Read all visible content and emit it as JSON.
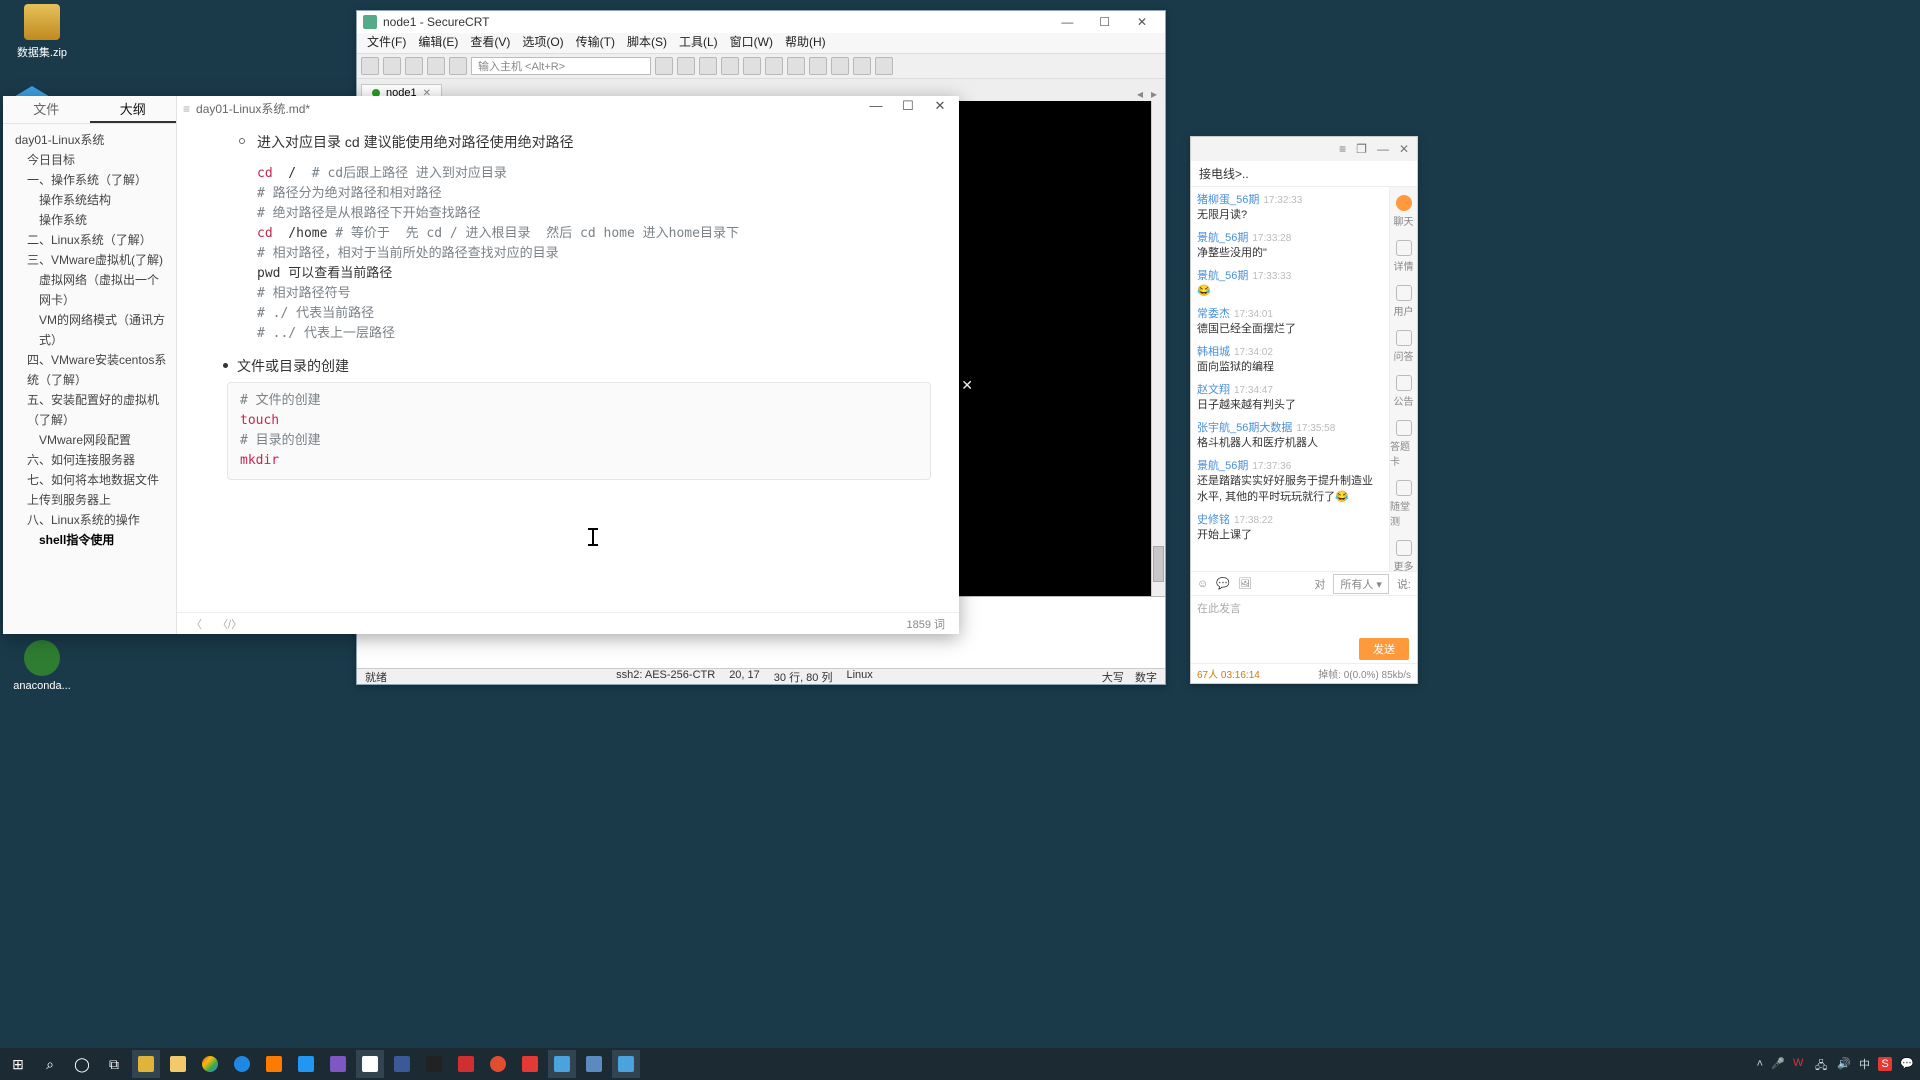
{
  "desktop": {
    "icon1": {
      "label": "数据集.zip"
    },
    "icon2": {
      "label": "anaconda..."
    }
  },
  "crt": {
    "title": "node1 - SecureCRT",
    "menu": [
      "文件(F)",
      "编辑(E)",
      "查看(V)",
      "选项(O)",
      "传输(T)",
      "脚本(S)",
      "工具(L)",
      "窗口(W)",
      "帮助(H)"
    ],
    "host_ph": "输入主机 <Alt+R>",
    "tab": "node1",
    "status": {
      "left": "就绪",
      "ssh": "ssh2: AES-256-CTR",
      "pos": "20, 17",
      "size": "30 行, 80 列",
      "os": "Linux",
      "caps": "大写",
      "num": "数字"
    }
  },
  "typ": {
    "file": "day01-Linux系统.md*",
    "tabs": {
      "file": "文件",
      "outline": "大纲"
    },
    "outline": [
      {
        "t": "day01-Linux系统",
        "lv": 0
      },
      {
        "t": "今日目标",
        "lv": 1
      },
      {
        "t": "一、操作系统（了解）",
        "lv": 1
      },
      {
        "t": "操作系统结构",
        "lv": 2
      },
      {
        "t": "操作系统",
        "lv": 2
      },
      {
        "t": "二、Linux系统（了解）",
        "lv": 1
      },
      {
        "t": "三、VMware虚拟机(了解)",
        "lv": 1
      },
      {
        "t": "虚拟网络（虚拟出一个网卡）",
        "lv": 2
      },
      {
        "t": "VM的网络模式（通讯方式）",
        "lv": 2
      },
      {
        "t": "四、VMware安装centos系统（了解）",
        "lv": 1
      },
      {
        "t": "五、安装配置好的虚拟机（了解）",
        "lv": 1
      },
      {
        "t": "VMware网段配置",
        "lv": 2
      },
      {
        "t": "六、如何连接服务器",
        "lv": 1
      },
      {
        "t": "七、如何将本地数据文件上传到服务器上",
        "lv": 1
      },
      {
        "t": "八、Linux系统的操作",
        "lv": 1
      },
      {
        "t": "shell指令使用",
        "lv": 2,
        "bold": true
      }
    ],
    "doc": {
      "bullet1": "进入对应目录 cd 建议能使用绝对路径使用绝对路径",
      "code1": [
        {
          "kw": "cd",
          "tx": "  /  ",
          "cm": "# cd后跟上路径 进入到对应目录"
        },
        {
          "tx": ""
        },
        {
          "cm": "# 路径分为绝对路径和相对路径"
        },
        {
          "cm": "# 绝对路径是从根路径下开始查找路径"
        },
        {
          "kw": "cd",
          "tx": "  /home ",
          "cm": "# 等价于  先 cd / 进入根目录  然后 cd home 进入home目录下"
        },
        {
          "cm": "# 相对路径，相对于当前所处的路径查找对应的目录"
        },
        {
          "tx": "pwd 可以查看当前路径"
        },
        {
          "tx": ""
        },
        {
          "cm": "# 相对路径符号"
        },
        {
          "cm": "# ./ 代表当前路径"
        },
        {
          "cm": "# ../ 代表上一层路径"
        }
      ],
      "bullet2": "文件或目录的创建",
      "code2": [
        {
          "cm": "# 文件的创建"
        },
        {
          "kw": "touch"
        },
        {
          "cm": "# 目录的创建"
        },
        {
          "kw": "mkdir"
        }
      ]
    },
    "footer": {
      "words": "1859 词"
    }
  },
  "chat": {
    "title": "接电线>..",
    "msgs": [
      {
        "u": "猪柳蛋_56期",
        "t": "17:32:33",
        "b": "无限月读?"
      },
      {
        "u": "景航_56期",
        "t": "17:33:28",
        "b": "净整些没用的\""
      },
      {
        "u": "景航_56期",
        "t": "17:33:33",
        "b": "😂"
      },
      {
        "u": "常委杰",
        "t": "17:34:01",
        "b": "德国已经全面摆烂了"
      },
      {
        "u": "韩相城",
        "t": "17:34:02",
        "b": "面向监狱的编程"
      },
      {
        "u": "赵文翔",
        "t": "17:34:47",
        "b": "日子越来越有判头了"
      },
      {
        "u": "张宇航_56期大数据",
        "t": "17:35:58",
        "b": "格斗机器人和医疗机器人"
      },
      {
        "u": "景航_56期",
        "t": "17:37:36",
        "b": "还是踏踏实实好好服务于提升制造业水平, 其他的平时玩玩就行了😂"
      },
      {
        "u": "史修铭",
        "t": "17:38:22",
        "b": "开始上课了"
      }
    ],
    "side": [
      "聊天",
      "详情",
      "用户",
      "问答",
      "公告",
      "答题卡",
      "随堂测",
      "更多"
    ],
    "tool": {
      "to": "对",
      "all": "所有人",
      "say": "说:"
    },
    "ph": "在此发言",
    "send": "发送",
    "foot": {
      "people": "67人",
      "time": "03:16:14",
      "drop": "掉帧: 0(0.0%) 85kb/s"
    }
  },
  "taskbar": {
    "tray": {
      "ime": "中"
    }
  }
}
